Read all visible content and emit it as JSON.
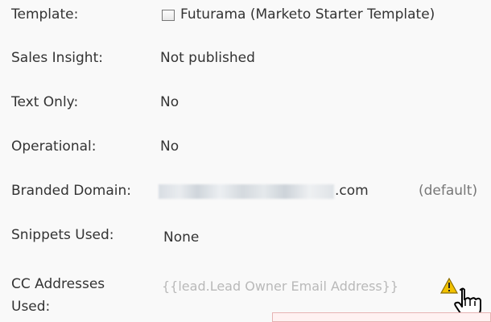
{
  "fields": {
    "template": {
      "label": "Template:",
      "value": "Futurama (Marketo Starter Template)",
      "icon": "template-icon"
    },
    "sales_insight": {
      "label": "Sales Insight:",
      "value": "Not published"
    },
    "text_only": {
      "label": "Text Only:",
      "value": "No"
    },
    "operational": {
      "label": "Operational:",
      "value": "No"
    },
    "branded_domain": {
      "label": "Branded Domain:",
      "value_suffix": ".com",
      "default_text": "(default)"
    },
    "snippets_used": {
      "label": "Snippets Used:",
      "value": "None"
    },
    "cc_addresses": {
      "label_line1": "CC Addresses",
      "label_line2": "Used:",
      "value": "{{lead.Lead Owner Email Address}}",
      "warning_icon": "warning-icon"
    }
  },
  "colors": {
    "text": "#333333",
    "muted": "#777777",
    "placeholder": "#b9b9b9",
    "warning": "#f2c200"
  }
}
